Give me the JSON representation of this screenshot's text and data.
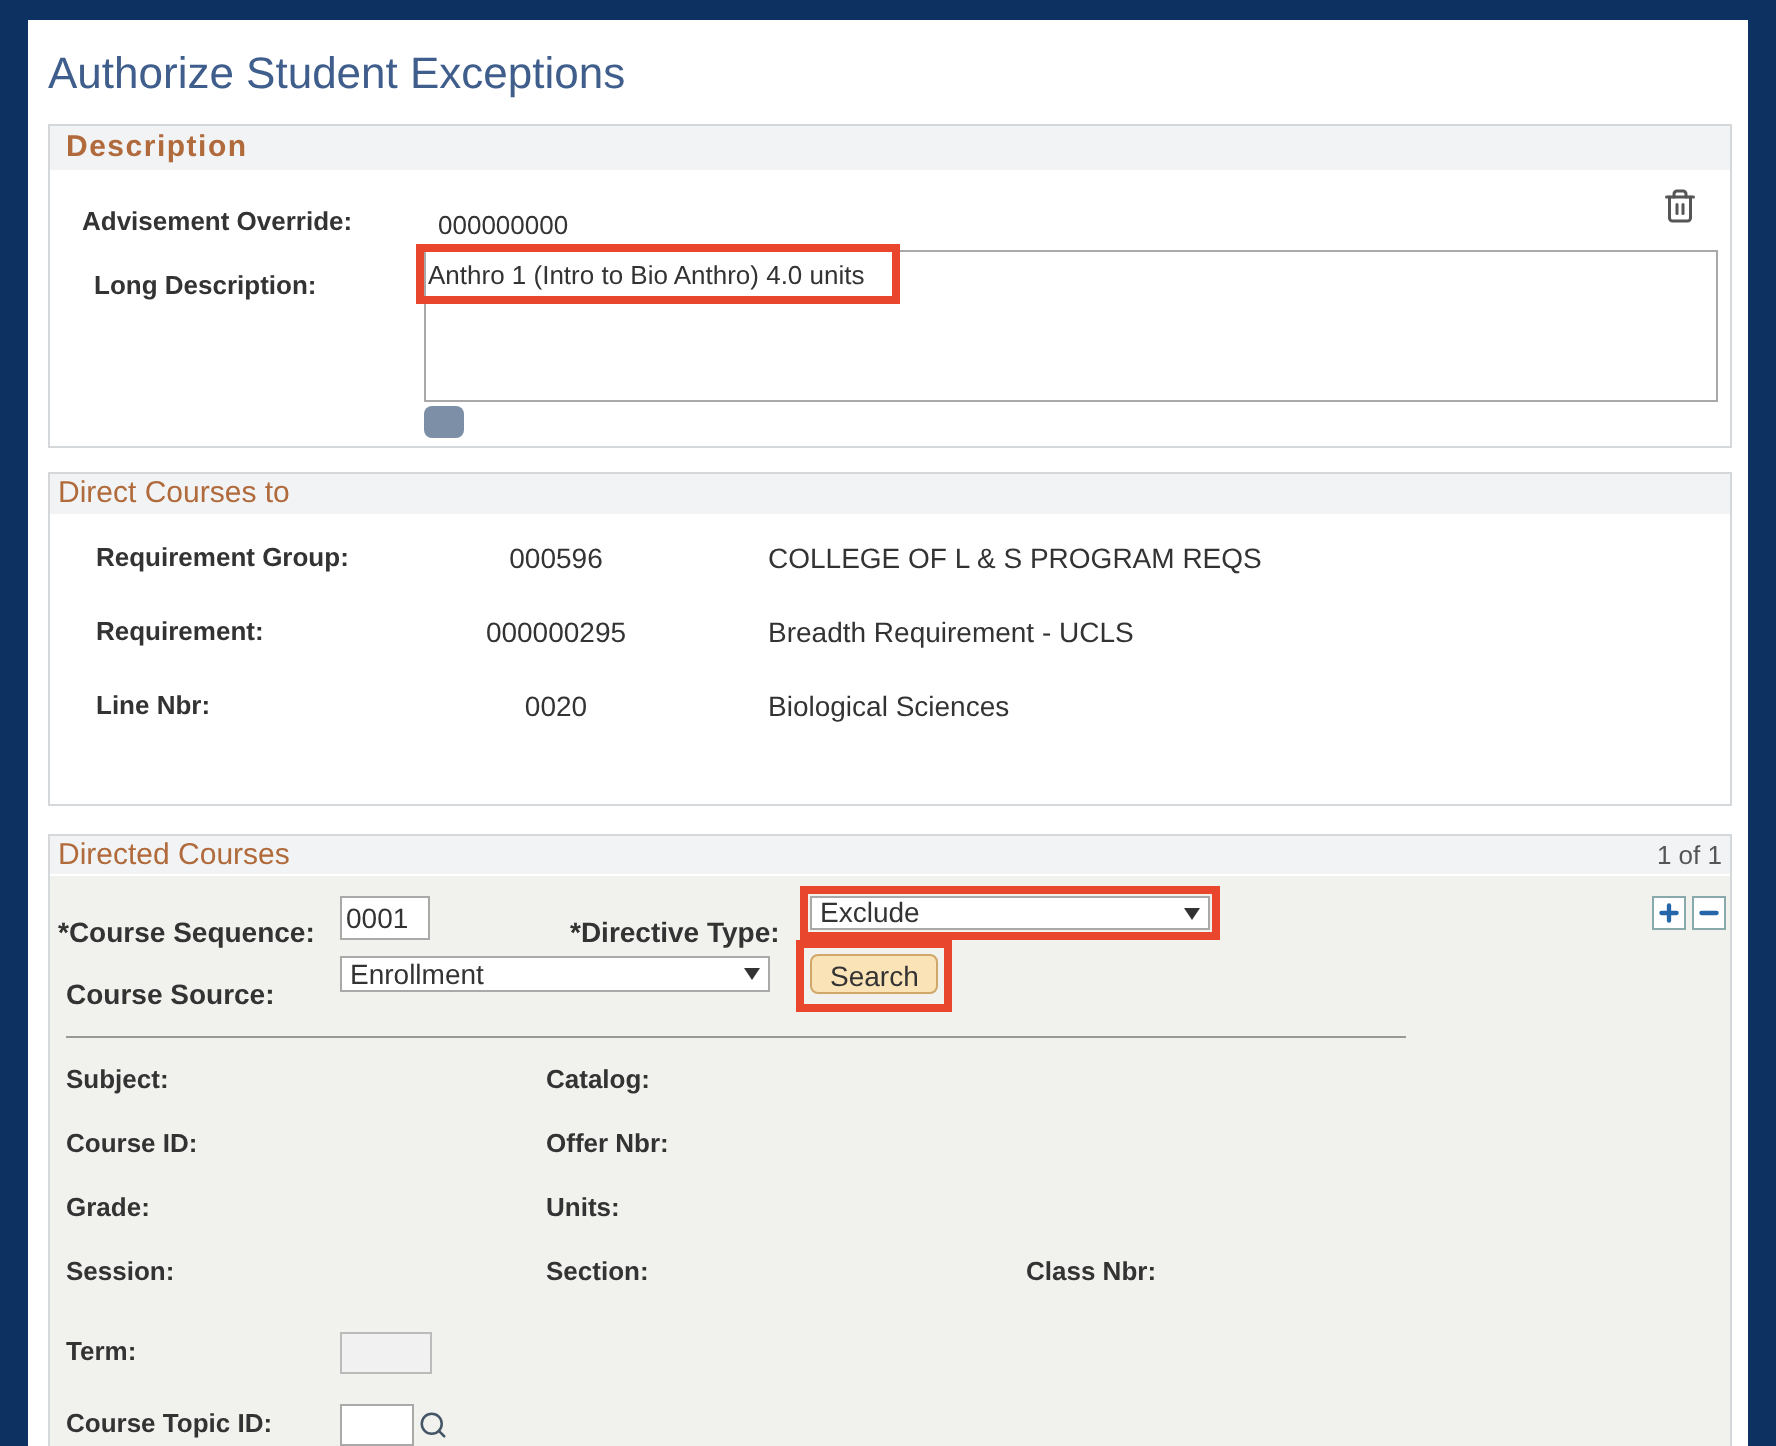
{
  "page_title": "Authorize Student Exceptions",
  "description": {
    "title": "Description",
    "advisement_override": {
      "label": "Advisement Override:",
      "value": "000000000"
    },
    "long_description": {
      "label": "Long Description:",
      "value": "Anthro 1 (Intro to Bio Anthro) 4.0 units",
      "highlighted": true
    }
  },
  "direct_courses_to": {
    "title": "Direct Courses to",
    "rows": [
      {
        "label": "Requirement Group:",
        "code": "000596",
        "text": "COLLEGE OF L & S PROGRAM REQS"
      },
      {
        "label": "Requirement:",
        "code": "000000295",
        "text": "Breadth Requirement - UCLS"
      },
      {
        "label": "Line Nbr:",
        "code": "0020",
        "text": "Biological Sciences"
      }
    ]
  },
  "directed_courses": {
    "title": "Directed Courses",
    "count": "1 of 1",
    "course_sequence": {
      "label": "*Course Sequence:",
      "value": "0001"
    },
    "directive_type": {
      "label": "*Directive Type:",
      "value": "Exclude",
      "highlighted": true
    },
    "course_source": {
      "label": "Course Source:",
      "value": "Enrollment"
    },
    "search_button": {
      "label": "Search",
      "highlighted": true
    },
    "details": [
      [
        "Subject:",
        "Catalog:"
      ],
      [
        "Course ID:",
        "Offer Nbr:"
      ],
      [
        "Grade:",
        "Units:"
      ],
      [
        "Session:",
        "Section:",
        "Class Nbr:"
      ]
    ],
    "term": {
      "label": "Term:"
    },
    "course_topic_id": {
      "label": "Course Topic ID:"
    }
  }
}
